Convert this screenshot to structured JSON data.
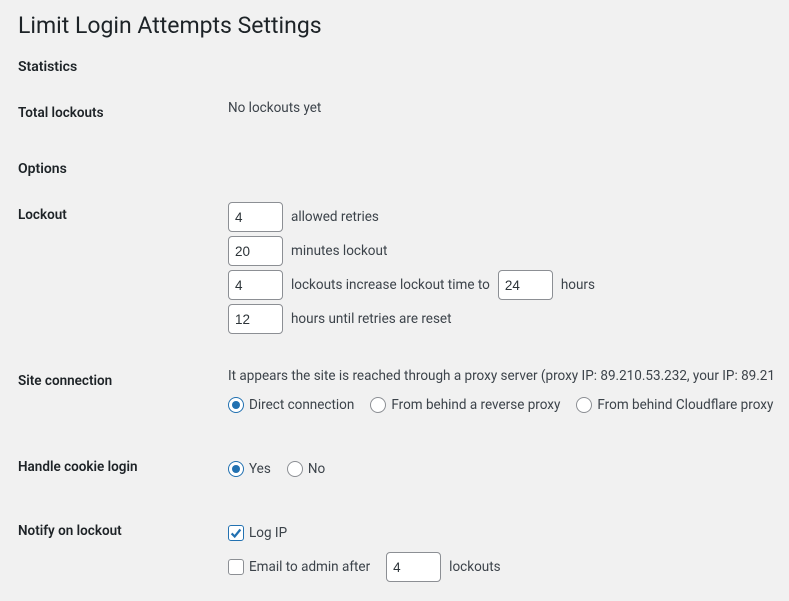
{
  "page_title": "Limit Login Attempts Settings",
  "statistics": {
    "heading": "Statistics",
    "total_lockouts_label": "Total lockouts",
    "total_lockouts_value": "No lockouts yet"
  },
  "options": {
    "heading": "Options",
    "lockout": {
      "label": "Lockout",
      "allowed_retries_value": "4",
      "allowed_retries_text": "allowed retries",
      "minutes_lockout_value": "20",
      "minutes_lockout_text": "minutes lockout",
      "increase_value": "4",
      "increase_text": "lockouts increase lockout time to",
      "increase_hours_value": "24",
      "increase_hours_text": "hours",
      "reset_value": "12",
      "reset_text": "hours until retries are reset"
    },
    "site_connection": {
      "label": "Site connection",
      "note": "It appears the site is reached through a proxy server (proxy IP: 89.210.53.232, your IP: 89.21",
      "direct": "Direct connection",
      "reverse": "From behind a reverse proxy",
      "cloudflare": "From behind Cloudflare proxy",
      "selected": "direct"
    },
    "cookie_login": {
      "label": "Handle cookie login",
      "yes": "Yes",
      "no": "No",
      "selected": "yes"
    },
    "notify": {
      "label": "Notify on lockout",
      "log_ip": "Log IP",
      "log_ip_checked": true,
      "email_admin": "Email to admin after",
      "email_admin_checked": false,
      "email_count": "4",
      "email_suffix": "lockouts"
    }
  }
}
